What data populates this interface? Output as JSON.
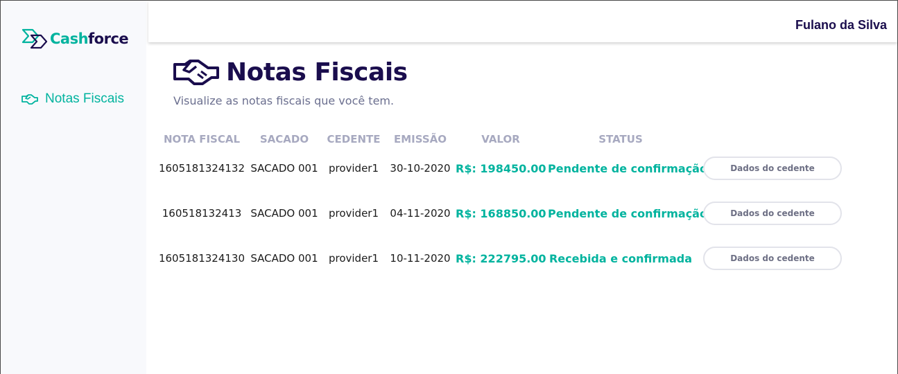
{
  "brand": {
    "name_part1": "Cash",
    "name_part2": "force"
  },
  "sidebar": {
    "items": [
      {
        "label": "Notas Fiscais",
        "icon": "handshake-icon"
      }
    ]
  },
  "header": {
    "user_name": "Fulano da Silva"
  },
  "main": {
    "title": "Notas Fiscais",
    "title_icon": "handshake-icon",
    "subtitle": "Visualize as notas fiscais que você tem."
  },
  "table": {
    "columns": [
      "NOTA FISCAL",
      "SACADO",
      "CEDENTE",
      "EMISSÃO",
      "VALOR",
      "STATUS"
    ],
    "rows": [
      {
        "nota": "1605181324132",
        "sacado": "SACADO 001",
        "cedente": "provider1",
        "emissao": "30-10-2020",
        "valor": "R$: 198450.00",
        "status": "Pendente de confirmação",
        "action": "Dados do cedente"
      },
      {
        "nota": "160518132413",
        "sacado": "SACADO 001",
        "cedente": "provider1",
        "emissao": "04-11-2020",
        "valor": "R$: 168850.00",
        "status": "Pendente de confirmação",
        "action": "Dados do cedente"
      },
      {
        "nota": "1605181324130",
        "sacado": "SACADO 001",
        "cedente": "provider1",
        "emissao": "10-11-2020",
        "valor": "R$: 222795.00",
        "status": "Recebida e confirmada",
        "action": "Dados do cedente"
      }
    ]
  },
  "colors": {
    "accent": "#00b39e",
    "brand_dark": "#1a0d4d",
    "muted": "#a7a9c0"
  }
}
